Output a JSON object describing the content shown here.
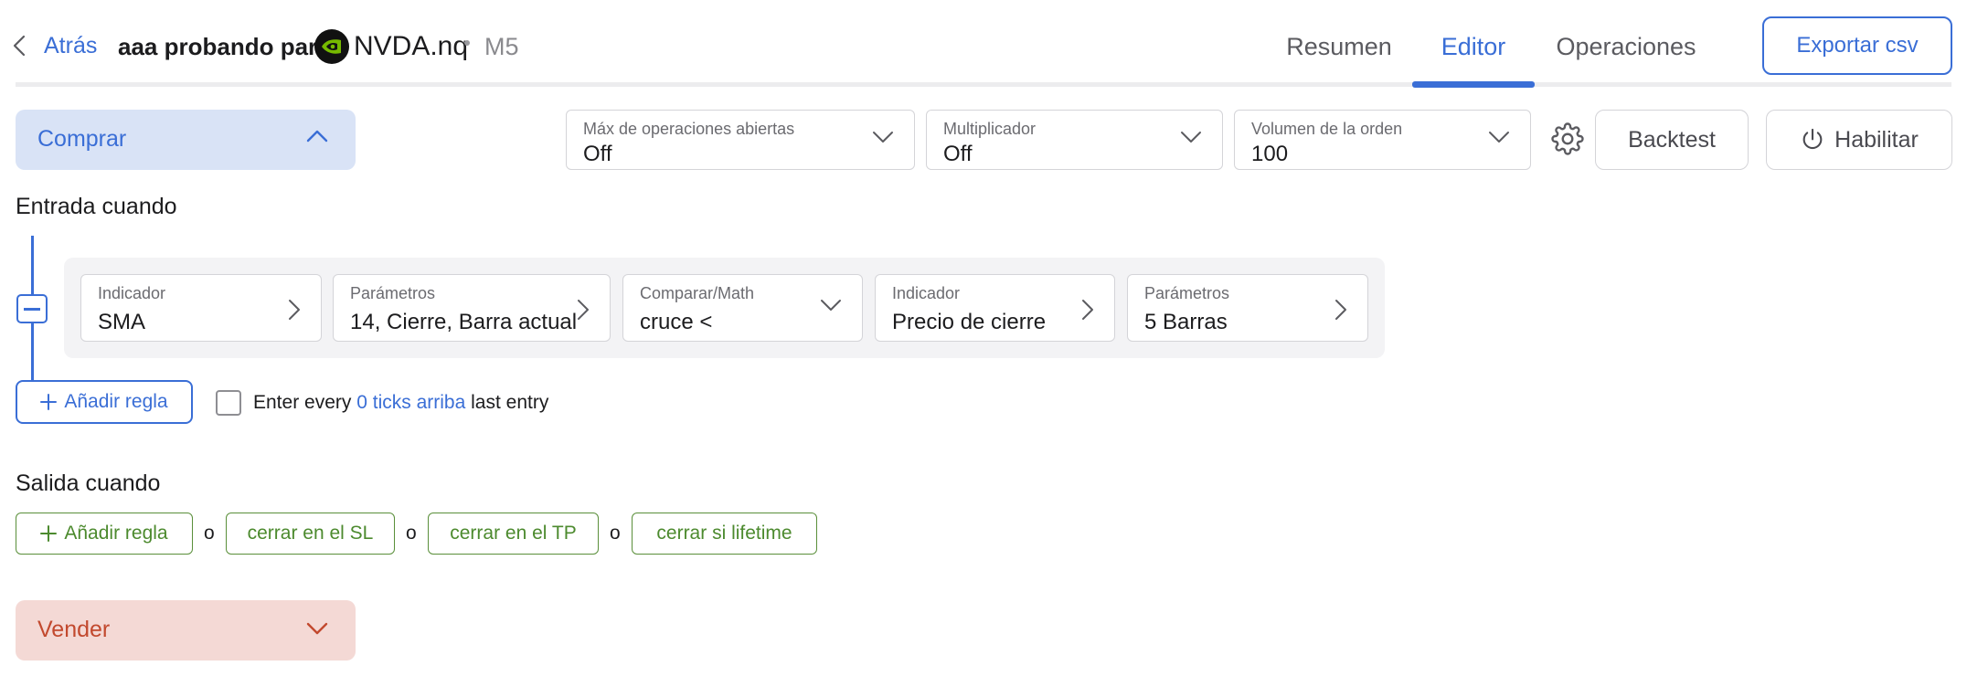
{
  "header": {
    "back_label": "Atrás",
    "strategy_title": "aaa probando para",
    "ticker": "NVDA.nq",
    "timeframe": "M5",
    "tabs": [
      {
        "label": "Resumen",
        "active": false
      },
      {
        "label": "Editor",
        "active": true
      },
      {
        "label": "Operaciones",
        "active": false
      }
    ],
    "export_label": "Exportar csv"
  },
  "colors": {
    "accent": "#3a6ed6",
    "buy_bg": "#d9e3f6",
    "sell_bg": "#f4d9d5",
    "sell_text": "#c2492e",
    "exit_green": "#4c8a2e",
    "nvidia_green": "#76b900"
  },
  "buy_section": {
    "label": "Comprar",
    "expanded": true
  },
  "controls": {
    "max_open": {
      "label": "Máx de operaciones abiertas",
      "value": "Off"
    },
    "multiplier": {
      "label": "Multiplicador",
      "value": "Off"
    },
    "order_volume": {
      "label": "Volumen de la orden",
      "value": "100"
    },
    "settings_icon": "gear-icon",
    "backtest_label": "Backtest",
    "enable_label": "Habilitar",
    "enable_icon": "power-icon"
  },
  "entry": {
    "title": "Entrada cuando",
    "rule": [
      {
        "label": "Indicador",
        "value": "SMA",
        "icon": "chevron-right-icon"
      },
      {
        "label": "Parámetros",
        "value": "14, Cierre, Barra actual",
        "icon": "chevron-right-icon"
      },
      {
        "label": "Comparar/Math",
        "value": "cruce <",
        "icon": "chevron-down-icon"
      },
      {
        "label": "Indicador",
        "value": "Precio de cierre",
        "icon": "chevron-right-icon"
      },
      {
        "label": "Parámetros",
        "value": "5 Barras",
        "icon": "chevron-right-icon"
      }
    ],
    "add_rule_label": "Añadir regla",
    "enter_every": {
      "prefix": "Enter every",
      "link": "0 ticks arriba",
      "suffix": "last entry",
      "checked": false
    }
  },
  "exit": {
    "title": "Salida cuando",
    "add_rule_label": "Añadir regla",
    "or_label": "o",
    "options": [
      "cerrar en el SL",
      "cerrar en el TP",
      "cerrar si lifetime"
    ]
  },
  "sell_section": {
    "label": "Vender",
    "expanded": false
  }
}
